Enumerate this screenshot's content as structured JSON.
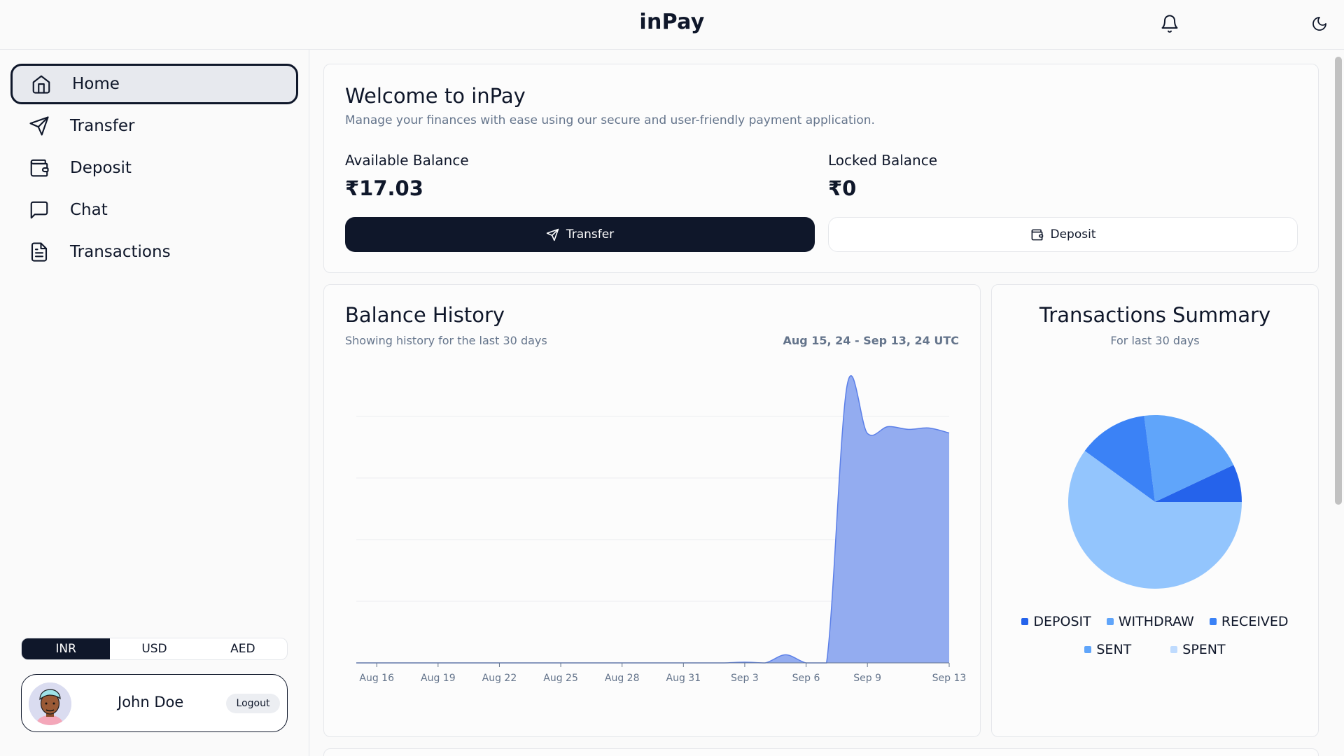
{
  "app": {
    "title": "inPay"
  },
  "header": {
    "bell_icon": "bell-icon",
    "theme_icon": "moon-icon"
  },
  "sidebar": {
    "items": [
      {
        "label": "Home",
        "icon": "home-icon",
        "active": true
      },
      {
        "label": "Transfer",
        "icon": "send-icon",
        "active": false
      },
      {
        "label": "Deposit",
        "icon": "wallet-icon",
        "active": false
      },
      {
        "label": "Chat",
        "icon": "chat-icon",
        "active": false
      },
      {
        "label": "Transactions",
        "icon": "document-icon",
        "active": false
      }
    ],
    "currencies": [
      "INR",
      "USD",
      "AED"
    ],
    "selected_currency": "INR",
    "user": {
      "name": "John Doe",
      "logout_label": "Logout"
    }
  },
  "welcome": {
    "title": "Welcome to inPay",
    "subtitle": "Manage your finances with ease using our secure and user-friendly payment application.",
    "available_label": "Available Balance",
    "available_value": "₹17.03",
    "locked_label": "Locked Balance",
    "locked_value": "₹0",
    "transfer_label": "Transfer",
    "deposit_label": "Deposit"
  },
  "balance_history": {
    "title": "Balance History",
    "subtitle": "Showing history for the last 30 days",
    "range": "Aug 15, 24 - Sep 13, 24 UTC"
  },
  "summary": {
    "title": "Transactions Summary",
    "subtitle": "For last 30 days"
  },
  "colors": {
    "primary": "#0f172a",
    "area": "#93acf0",
    "area_stroke": "#5b7fe8"
  },
  "chart_data": [
    {
      "type": "area",
      "title": "Balance History",
      "x_ticks": [
        "Aug 16",
        "Aug 19",
        "Aug 22",
        "Aug 25",
        "Aug 28",
        "Aug 31",
        "Sep 3",
        "Sep 6",
        "Sep 9",
        "Sep 13"
      ],
      "x": [
        "Aug 15",
        "Aug 16",
        "Aug 17",
        "Aug 18",
        "Aug 19",
        "Aug 20",
        "Aug 21",
        "Aug 22",
        "Aug 23",
        "Aug 24",
        "Aug 25",
        "Aug 26",
        "Aug 27",
        "Aug 28",
        "Aug 29",
        "Aug 30",
        "Aug 31",
        "Sep 1",
        "Sep 2",
        "Sep 3",
        "Sep 4",
        "Sep 5",
        "Sep 6",
        "Sep 7",
        "Sep 8",
        "Sep 9",
        "Sep 10",
        "Sep 11",
        "Sep 12",
        "Sep 13"
      ],
      "values": [
        0,
        0,
        0,
        0,
        0,
        0,
        0,
        0,
        0,
        0,
        0,
        0,
        0,
        0,
        0,
        0,
        0,
        0,
        0,
        0.05,
        0,
        0.6,
        0,
        0,
        20.5,
        17,
        17.5,
        17.3,
        17.4,
        17.03
      ],
      "ylim": [
        0,
        21
      ],
      "grid": true,
      "xlabel": "",
      "ylabel": ""
    },
    {
      "type": "pie",
      "title": "Transactions Summary",
      "legend_position": "bottom",
      "slices": [
        {
          "label": "DEPOSIT",
          "value": 7,
          "color": "#2563eb"
        },
        {
          "label": "WITHDRAW",
          "value": 20,
          "color": "#60a5fa"
        },
        {
          "label": "RECEIVED",
          "value": 13,
          "color": "#3b82f6"
        },
        {
          "label": "SENT",
          "value": 0,
          "color": "#60a5fa"
        },
        {
          "label": "SPENT",
          "value": 60,
          "color": "#93c5fd"
        }
      ]
    }
  ]
}
